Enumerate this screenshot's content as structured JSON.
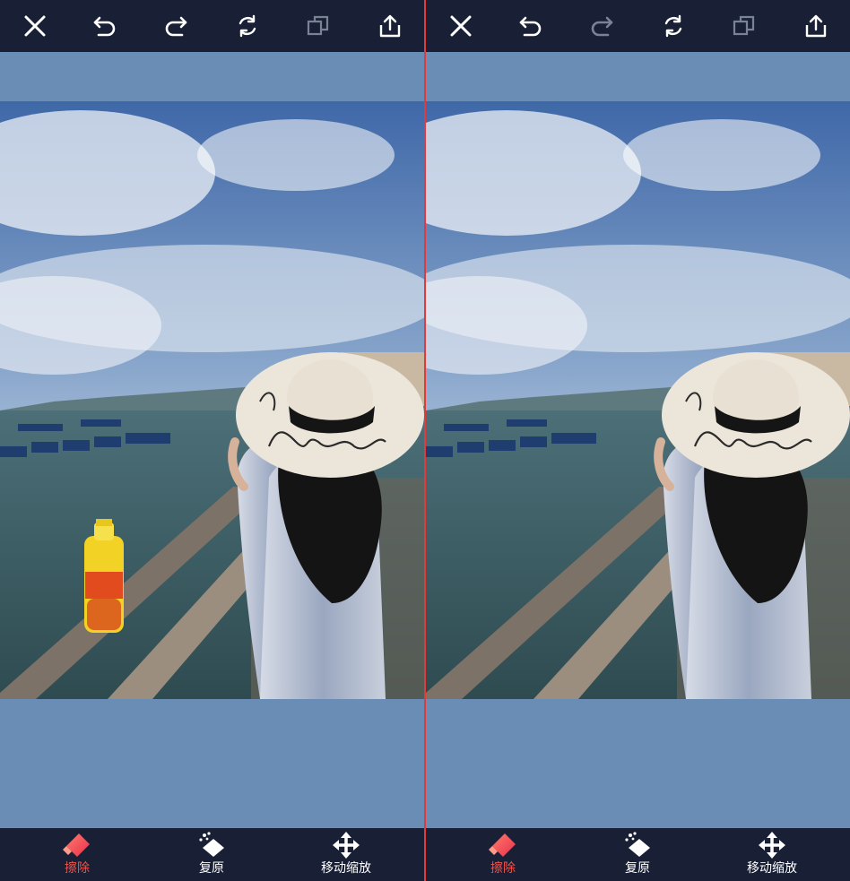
{
  "toolbar": {
    "buttons": [
      {
        "name": "close",
        "icon": "close-icon",
        "enabled": true
      },
      {
        "name": "undo",
        "icon": "undo-icon",
        "enabled": true
      },
      {
        "name": "redo",
        "icon": "redo-icon",
        "enabled": true
      },
      {
        "name": "reset",
        "icon": "refresh-icon",
        "enabled": true
      },
      {
        "name": "compare",
        "icon": "layers-icon",
        "enabled": false
      },
      {
        "name": "export",
        "icon": "share-icon",
        "enabled": true
      }
    ]
  },
  "left_panel": {
    "redo_enabled": true,
    "bottle_visible": true
  },
  "right_panel": {
    "redo_enabled": false,
    "bottle_visible": false
  },
  "tools": {
    "erase": {
      "label": "擦除",
      "icon": "eraser-icon",
      "active": true
    },
    "restore": {
      "label": "复原",
      "icon": "magic-eraser-icon",
      "active": false
    },
    "move_zoom": {
      "label": "移动缩放",
      "icon": "move-arrows-icon",
      "active": false
    }
  },
  "colors": {
    "bar_bg": "#192035",
    "canvas_bg": "#6a8db5",
    "divider": "#e23a3a",
    "active": "#f0524a",
    "icon": "#ffffff",
    "icon_disabled": "#7a8296"
  }
}
